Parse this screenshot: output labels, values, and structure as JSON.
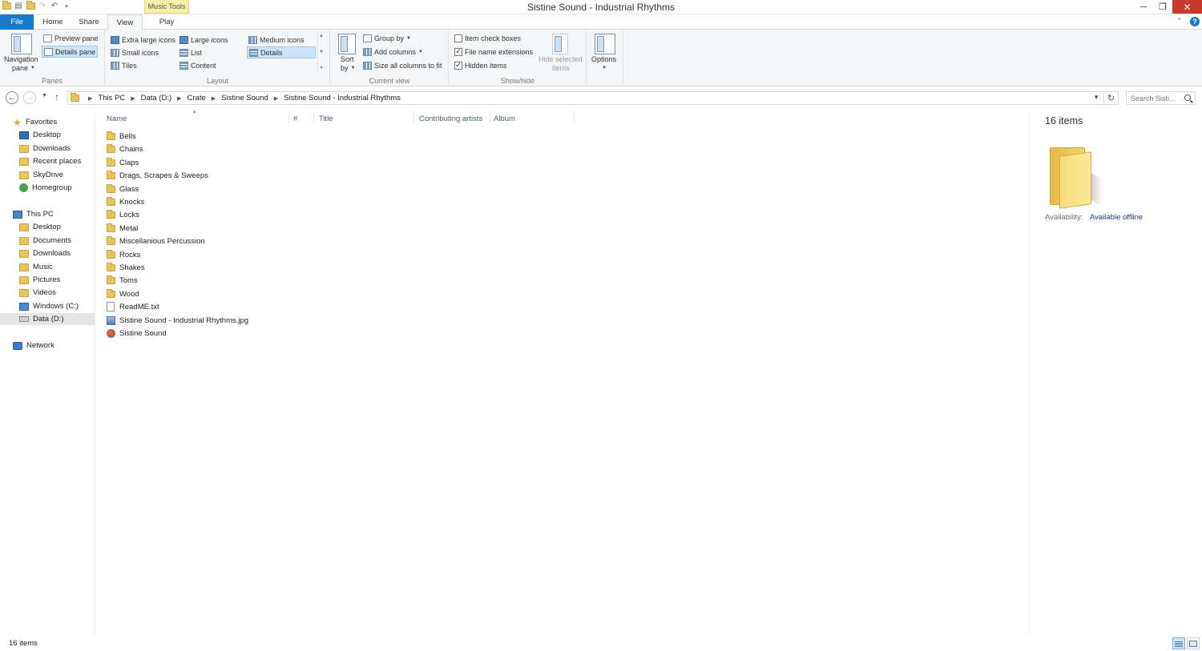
{
  "window": {
    "title": "Sistine Sound - Industrial Rhythms",
    "context_tab": "Music Tools",
    "close_glyph": "✕",
    "max_glyph": "❐",
    "min_glyph": "─"
  },
  "tabs": [
    "File",
    "Home",
    "Share",
    "View",
    "Play"
  ],
  "ribbon": {
    "panes": {
      "label": "Panes",
      "navigation_pane": "Navigation",
      "navigation_pane2": "pane",
      "preview_pane": "Preview pane",
      "details_pane": "Details pane"
    },
    "layout": {
      "label": "Layout",
      "items": [
        "Extra large icons",
        "Large icons",
        "Medium icons",
        "Small icons",
        "List",
        "Details",
        "Tiles",
        "Content"
      ],
      "selected": "Details"
    },
    "current_view": {
      "label": "Current view",
      "sort": "Sort",
      "sort2": "by",
      "group_by": "Group by",
      "add_columns": "Add columns",
      "size_columns": "Size all columns to fit"
    },
    "show_hide": {
      "label": "Show/hide",
      "item_check_boxes": "Item check boxes",
      "file_name_extensions": "File name extensions",
      "hidden_items": "Hidden items",
      "hide_selected": "Hide selected",
      "hide_selected2": "items",
      "checks": {
        "item_check_boxes": false,
        "file_name_extensions": true,
        "hidden_items": true
      }
    },
    "options": "Options"
  },
  "address": {
    "crumbs": [
      "This PC",
      "Data (D:)",
      "Crate",
      "Sistine Sound",
      "Sistine Sound - Industrial Rhythms"
    ],
    "search_placeholder": "Search Sisti..."
  },
  "nav": {
    "favorites": {
      "label": "Favorites",
      "items": [
        "Desktop",
        "Downloads",
        "Recent places"
      ]
    },
    "skydrive": "SkyDrive",
    "homegroup": "Homegroup",
    "this_pc": {
      "label": "This PC",
      "items": [
        "Desktop",
        "Documents",
        "Downloads",
        "Music",
        "Pictures",
        "Videos",
        "Windows (C:)",
        "Data (D:)"
      ]
    },
    "network": "Network",
    "selected": "Data (D:)"
  },
  "columns": [
    "Name",
    "#",
    "Title",
    "Contributing artists",
    "Album"
  ],
  "files": [
    {
      "name": "Bells",
      "type": "folder"
    },
    {
      "name": "Chains",
      "type": "folder"
    },
    {
      "name": "Claps",
      "type": "folder"
    },
    {
      "name": "Drags, Scrapes & Sweeps",
      "type": "folder"
    },
    {
      "name": "Glass",
      "type": "folder"
    },
    {
      "name": "Knocks",
      "type": "folder"
    },
    {
      "name": "Locks",
      "type": "folder"
    },
    {
      "name": "Metal",
      "type": "folder"
    },
    {
      "name": "Miscellanious Percussion",
      "type": "folder"
    },
    {
      "name": "Rocks",
      "type": "folder"
    },
    {
      "name": "Shakes",
      "type": "folder"
    },
    {
      "name": "Toms",
      "type": "folder"
    },
    {
      "name": "Wood",
      "type": "folder"
    },
    {
      "name": "ReadME.txt",
      "type": "text"
    },
    {
      "name": "Sistine Sound - Industrial Rhythms.jpg",
      "type": "image"
    },
    {
      "name": "Sistine Sound",
      "type": "shortcut"
    }
  ],
  "details": {
    "count": "16 items",
    "availability_label": "Availability:",
    "availability_value": "Available offline"
  },
  "status": {
    "text": "16 items"
  },
  "colors": {
    "accent": "#1979ca",
    "close": "#c7382d",
    "selection": "#cce4f7"
  }
}
